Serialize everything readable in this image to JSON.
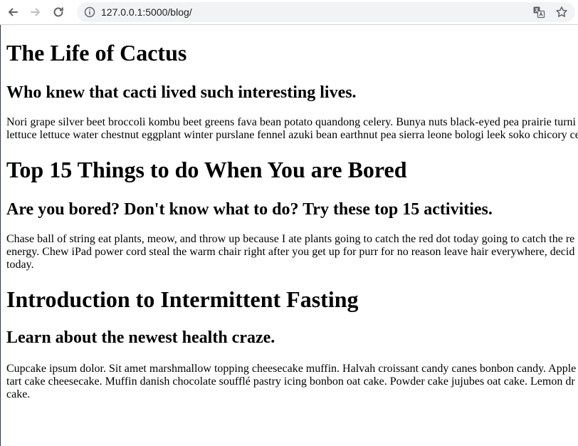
{
  "browser": {
    "url": "127.0.0.1:5000/blog/"
  },
  "posts": [
    {
      "title": "The Life of Cactus",
      "subtitle": "Who knew that cacti lived such interesting lives.",
      "body_lines": [
        "Nori grape silver beet broccoli kombu beet greens fava bean potato quandong celery. Bunya nuts black-eyed pea prairie turni",
        "lettuce lettuce water chestnut eggplant winter purslane fennel azuki bean earthnut pea sierra leone bologi leek soko chicory ce"
      ]
    },
    {
      "title": "Top 15 Things to do When You are Bored",
      "subtitle": "Are you bored? Don't know what to do? Try these top 15 activities.",
      "body_lines": [
        "Chase ball of string eat plants, meow, and throw up because I ate plants going to catch the red dot today going to catch the re",
        "energy. Chew iPad power cord steal the warm chair right after you get up for purr for no reason leave hair everywhere, decid",
        "today."
      ]
    },
    {
      "title": "Introduction to Intermittent Fasting",
      "subtitle": "Learn about the newest health craze.",
      "body_lines": [
        "Cupcake ipsum dolor. Sit amet marshmallow topping cheesecake muffin. Halvah croissant candy canes bonbon candy. Apple",
        "tart cake cheesecake. Muffin danish chocolate soufflé pastry icing bonbon oat cake. Powder cake jujubes oat cake. Lemon dr",
        "cake."
      ]
    }
  ]
}
